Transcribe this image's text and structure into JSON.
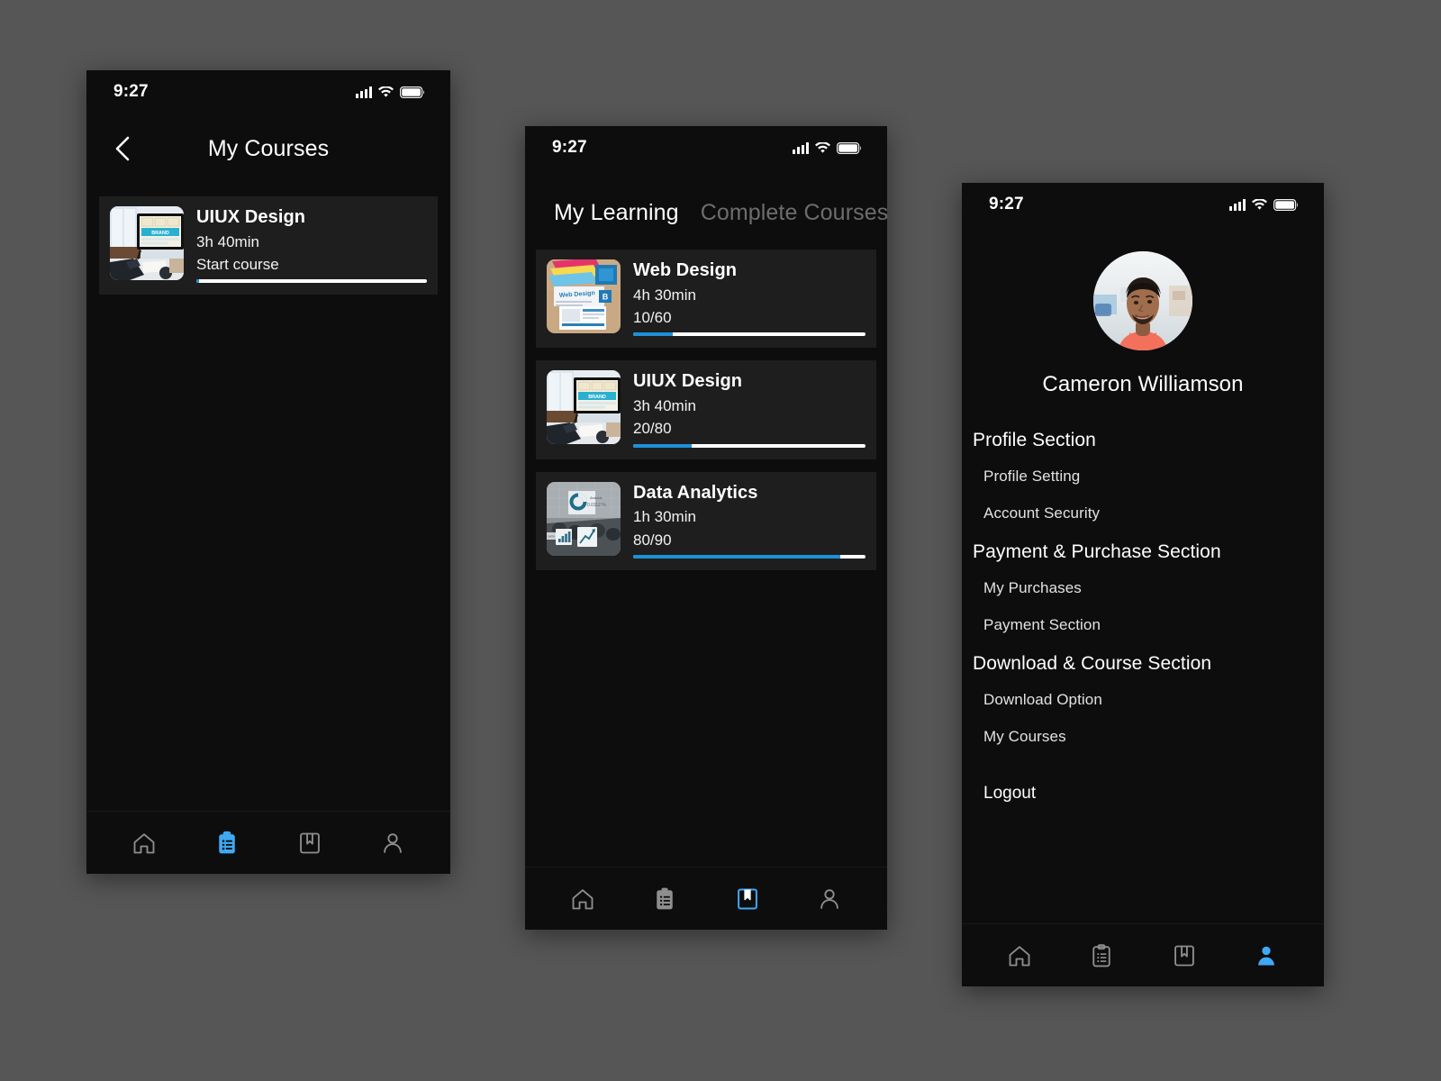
{
  "canvas": {
    "background": "#565656",
    "accent": "#1e90d8",
    "screen_bg": "#0d0d0d",
    "card_bg": "#1e1e1e"
  },
  "status_bar": {
    "time": "9:27",
    "icons": [
      "signal-icon",
      "wifi-icon",
      "battery-icon"
    ]
  },
  "screen_courses": {
    "header": {
      "back_icon": "chevron-left-icon",
      "title": "My Courses"
    },
    "courses": [
      {
        "title": "UIUX Design",
        "duration": "3h 40min",
        "meta": "Start course",
        "progress_percent": 1,
        "thumb": "uiux-design-thumbnail"
      }
    ],
    "bottom_nav": {
      "items": [
        {
          "icon": "home-icon",
          "active": false
        },
        {
          "icon": "clipboard-icon",
          "active": true
        },
        {
          "icon": "bookmark-icon",
          "active": false
        },
        {
          "icon": "person-icon",
          "active": false
        }
      ]
    }
  },
  "screen_learning": {
    "tabs": [
      {
        "label": "My Learning",
        "active": true
      },
      {
        "label": "Complete Courses",
        "active": false
      }
    ],
    "courses": [
      {
        "title": "Web Design",
        "duration": "4h 30min",
        "meta": "10/60",
        "progress_percent": 17,
        "thumb": "web-design-thumbnail"
      },
      {
        "title": "UIUX Design",
        "duration": "3h 40min",
        "meta": "20/80",
        "progress_percent": 25,
        "thumb": "uiux-design-thumbnail"
      },
      {
        "title": "Data Analytics",
        "duration": "1h 30min",
        "meta": "80/90",
        "progress_percent": 89,
        "thumb": "data-analytics-thumbnail"
      }
    ],
    "bottom_nav": {
      "items": [
        {
          "icon": "home-icon",
          "active": false
        },
        {
          "icon": "clipboard-icon",
          "active": false
        },
        {
          "icon": "bookmark-icon",
          "active": true
        },
        {
          "icon": "person-icon",
          "active": false
        }
      ]
    }
  },
  "screen_profile": {
    "avatar": "user-avatar-photo",
    "name": "Cameron Williamson",
    "sections": [
      {
        "heading": "Profile Section",
        "items": [
          "Profile Setting",
          "Account Security"
        ]
      },
      {
        "heading": "Payment & Purchase Section",
        "items": [
          "My Purchases",
          "Payment Section"
        ]
      },
      {
        "heading": "Download & Course Section",
        "items": [
          "Download Option",
          "My Courses"
        ]
      }
    ],
    "logout_label": "Logout",
    "bottom_nav": {
      "items": [
        {
          "icon": "home-icon",
          "active": false
        },
        {
          "icon": "clipboard-icon",
          "active": false
        },
        {
          "icon": "bookmark-icon",
          "active": false
        },
        {
          "icon": "person-icon",
          "active": true
        }
      ]
    }
  }
}
